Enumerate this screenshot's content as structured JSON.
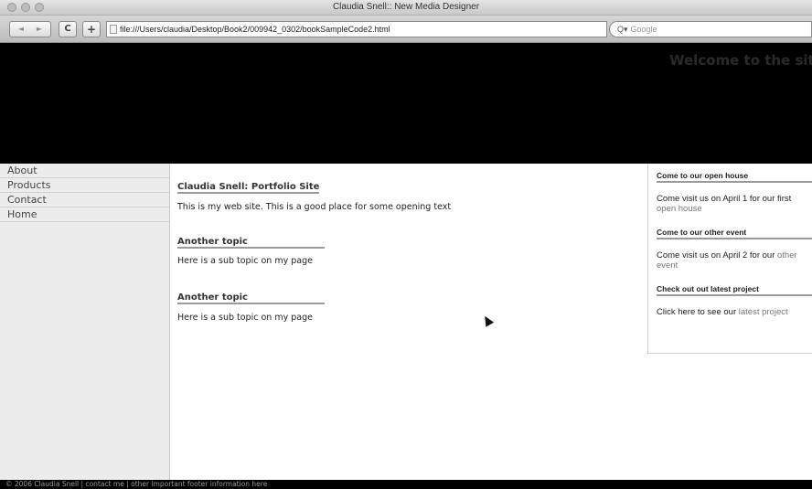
{
  "window": {
    "title": "Claudia Snell:: New Media Designer"
  },
  "toolbar": {
    "back_label": "◄",
    "forward_label": "►",
    "reload_label": "C",
    "add_label": "+",
    "url": "file:///Users/claudia/Desktop/Book2/009942_0302/bookSampleCode2.html",
    "search_placeholder": "Google",
    "search_icon": "Q▾"
  },
  "header": {
    "title": "Welcome to the site"
  },
  "nav": {
    "items": [
      {
        "label": "About"
      },
      {
        "label": "Products"
      },
      {
        "label": "Contact"
      },
      {
        "label": "Home"
      }
    ]
  },
  "main": {
    "sections": [
      {
        "heading": "Claudia Snell: Portfolio Site",
        "text": "This is my web site. This is a good place for some opening text"
      },
      {
        "heading": "Another topic",
        "text": "Here is a sub topic on my page"
      },
      {
        "heading": "Another topic",
        "text": "Here is a sub topic on my page"
      }
    ]
  },
  "sidebar": {
    "boxes": [
      {
        "heading": "Come to our open house",
        "text": "Come visit us on April 1 for our first ",
        "link": "open house"
      },
      {
        "heading": "Come to our other event",
        "text": "Come visit us on April 2 for our ",
        "link": "other event"
      },
      {
        "heading": "Check out out latest project",
        "text": "Click here to see our ",
        "link": "latest project"
      }
    ]
  },
  "footer": {
    "text": "© 2006 Claudia Snell | contact me | other important footer information here"
  }
}
